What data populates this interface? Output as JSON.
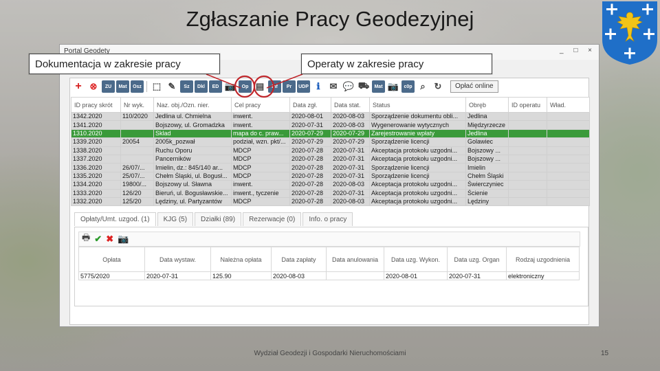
{
  "slide": {
    "title": "Zgłaszanie Pracy Geodezyjnej",
    "footer": "Wydział Geodezji i Gospodarki Nieruchomościami",
    "page_number": "15"
  },
  "callouts": {
    "left": "Dokumentacja w zakresie pracy",
    "right": "Operaty w zakresie pracy"
  },
  "window": {
    "title": "Portal Geodety",
    "controls": "_ □ ×"
  },
  "toolbar": {
    "buttons": [
      "ZU",
      "Mat",
      "Osz",
      "Sz",
      "Dkl",
      "ED",
      "Op",
      "Inf",
      "Pr",
      "UDP",
      "Mat",
      "c0p"
    ],
    "online_button": "Opłać online"
  },
  "main_table": {
    "columns": [
      "ID pracy skrót",
      "Nr wyk.",
      "Naz. obj./Ozn. nier.",
      "Cel pracy",
      "Data zgł.",
      "Data stat.",
      "Status",
      "Obręb",
      "ID operatu",
      "Wład."
    ],
    "rows": [
      [
        "1342.2020",
        "110/2020",
        "Jedlina ul. Chmielna",
        "inwent.",
        "2020-08-01",
        "2020-08-03",
        "Sporządzenie dokumentu obli...",
        "Jedlina",
        "",
        ""
      ],
      [
        "1341.2020",
        "",
        "Bojszowy, ul. Gromadzka",
        "inwent.",
        "2020-07-31",
        "2020-08-03",
        "Wygenerowanie wytycznych",
        "Międzyrzecze",
        "",
        ""
      ],
      [
        "1310.2020",
        "",
        "Sklad",
        "mapa do c. praw...",
        "2020-07-29",
        "2020-07-29",
        "Zarejestrowanie wpłaty",
        "Jedlina",
        "",
        ""
      ],
      [
        "1339.2020",
        "20054",
        "2005k_pozwał",
        "podział, wzn. pkt/...",
        "2020-07-29",
        "2020-07-29",
        "Sporządzenie licencji",
        "Golawiec",
        "",
        ""
      ],
      [
        "1338.2020",
        "",
        "Ruchu Oporu",
        "MDCP",
        "2020-07-28",
        "2020-07-31",
        "Akceptacja protokołu uzgodni...",
        "Bojszowy ...",
        "",
        ""
      ],
      [
        "1337.2020",
        "",
        "Pancerników",
        "MDCP",
        "2020-07-28",
        "2020-07-31",
        "Akceptacja protokołu uzgodni...",
        "Bojszowy ...",
        "",
        ""
      ],
      [
        "1336.2020",
        "26/07/...",
        "Imielin, dz.: 845/140 ar...",
        "MDCP",
        "2020-07-28",
        "2020-07-31",
        "Sporządzenie licencji",
        "Imielin",
        "",
        ""
      ],
      [
        "1335.2020",
        "25/07/...",
        "Chełm Śląski, ul. Bogusł...",
        "MDCP",
        "2020-07-28",
        "2020-07-31",
        "Sporządzenie licencji",
        "Chełm Śląski",
        "",
        ""
      ],
      [
        "1334.2020",
        "19800/...",
        "Bojszowy ul. Sławna",
        "inwent.",
        "2020-07-28",
        "2020-08-03",
        "Akceptacja protokołu uzgodni...",
        "Świerczyniec",
        "",
        ""
      ],
      [
        "1333.2020",
        "126/20",
        "Bieruń, ul. Bogusławskie...",
        "inwent., tyczenie",
        "2020-07-28",
        "2020-07-31",
        "Akceptacja protokołu uzgodni...",
        "Ścienie",
        "",
        ""
      ],
      [
        "1332.2020",
        "125/20",
        "Lędziny, ul. Partyzantów",
        "MDCP",
        "2020-07-28",
        "2020-08-03",
        "Akceptacja protokołu uzgodni...",
        "Lędziny",
        "",
        ""
      ]
    ],
    "selected_row": 2
  },
  "tabs": [
    "Opłaty/Umt. uzgod. (1)",
    "KJG (5)",
    "Działki (89)",
    "Rezerwacje (0)",
    "Info. o pracy"
  ],
  "payments_table": {
    "columns": [
      "Opłata",
      "Data wystaw.",
      "Należna opłata",
      "Data zapłaty",
      "Data anulowania",
      "Data uzg. Wykon.",
      "Data uzg. Organ",
      "Rodzaj uzgodnienia"
    ],
    "rows": [
      [
        "5775/2020",
        "2020-07-31",
        "125.90",
        "2020-08-03",
        "",
        "2020-08-01",
        "2020-07-31",
        "elektroniczny"
      ]
    ]
  },
  "colors": {
    "selected_row": "#3a9a3a",
    "callout_circle": "#c0262b",
    "crest_blue": "#1f6fc8",
    "crest_eagle": "#f2c417"
  }
}
